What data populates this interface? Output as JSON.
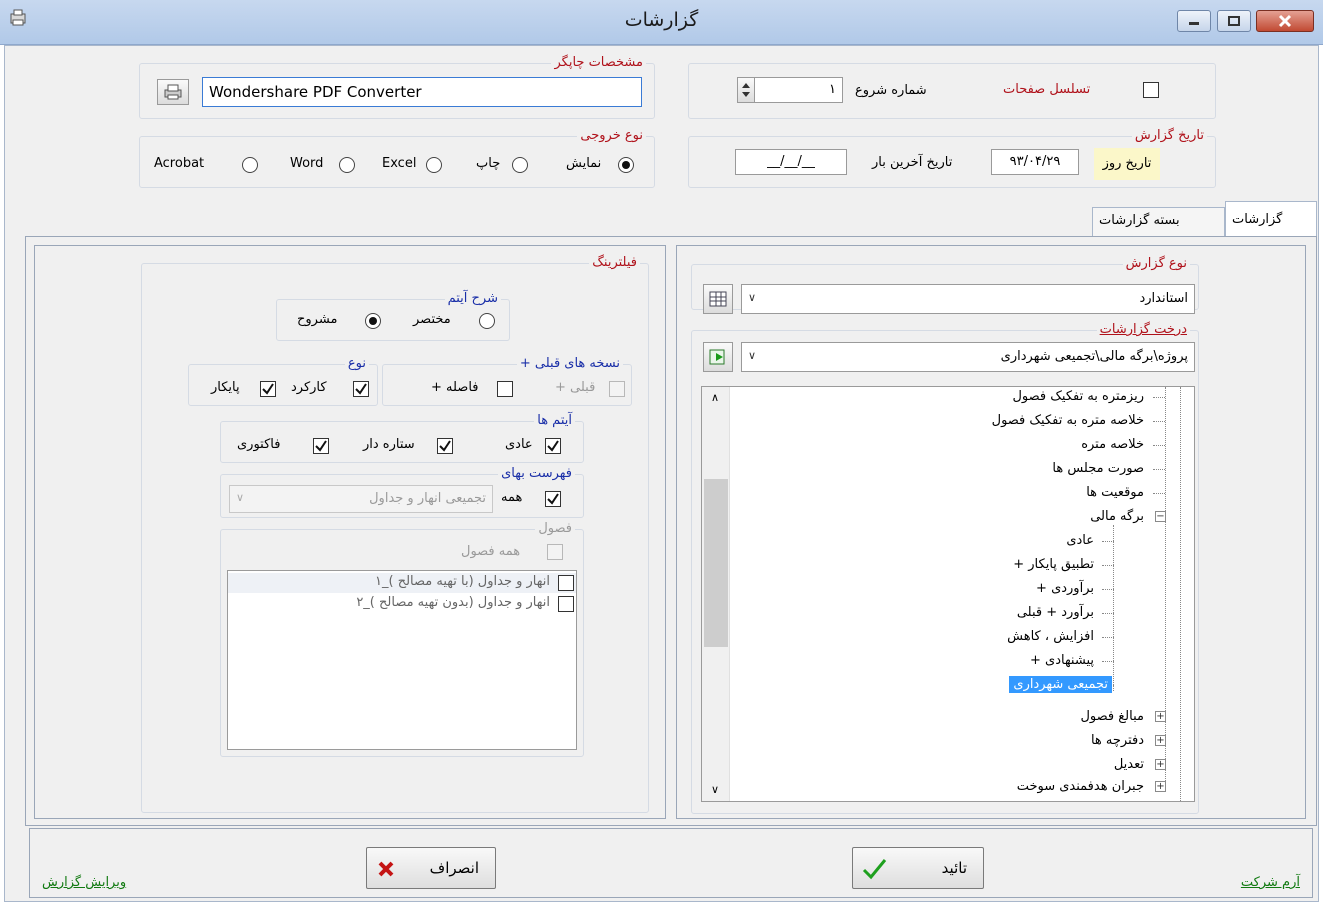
{
  "window": {
    "title": "گزارشات"
  },
  "printer": {
    "legend": "مشخصات چاپگر",
    "name": "Wondershare PDF Converter"
  },
  "pages": {
    "sequence_label": "تسلسل صفحات",
    "start_label": "شماره شروع",
    "start_value": "۱"
  },
  "output": {
    "legend": "نوع خروجی",
    "options": [
      "نمایش",
      "چاپ",
      "Excel",
      "Word",
      "Acrobat"
    ],
    "selected": "نمایش"
  },
  "report_date": {
    "legend": "تاریخ گزارش",
    "today_label": "تاریخ روز",
    "today_value": "۹۳/۰۴/۲۹",
    "last_label": "تاریخ آخرین بار",
    "last_value": "__/__/__"
  },
  "tabs": [
    {
      "label": "گزارشات",
      "active": true
    },
    {
      "label": "بسته گزارشات",
      "active": false
    }
  ],
  "report_type": {
    "legend": "نوع گزارش",
    "value": "استاندارد"
  },
  "report_tree": {
    "legend": "درخت گزارشات",
    "path": "پروژه\\برگه مالی\\تجمیعی شهرداری",
    "items": [
      "ریزمتره به تفکیک فصول",
      "خلاصه متره به تفکیک فصول",
      "خلاصه متره",
      "صورت مجلس ها",
      "موقعیت ها",
      "برگه مالی",
      "عادی",
      "+ تطبیق پایکار",
      "+ برآوردی",
      "برآورد + قبلی",
      "افزایش ، کاهش",
      "+ پیشنهادی",
      "تجمیعی شهرداری",
      "مبالغ فصول",
      "دفترچه ها",
      "تعدیل",
      "جبران هدفمندی سوخت"
    ],
    "selected": "تجمیعی شهرداری"
  },
  "filter": {
    "legend": "فیلترینگ",
    "item_desc": {
      "legend": "شرح آیتم",
      "options": [
        "مشروح",
        "مختصر"
      ],
      "selected": "مشروح"
    },
    "prev_versions": {
      "legend": "+ نسخه های قبلی",
      "options": [
        "+ فاصله",
        "+ قبلی"
      ]
    },
    "kind": {
      "legend": "نوع",
      "options": [
        "کارکرد",
        "پایکار"
      ]
    },
    "items": {
      "legend": "آیتم ها",
      "options": [
        "عادی",
        "ستاره دار",
        "فاکتوری"
      ]
    },
    "price_list": {
      "legend": "فهرست بهای",
      "all_label": "همه",
      "combo_value": "تجمیعی انهار و جداول"
    },
    "chapters": {
      "legend": "فصول",
      "all_label": "همه فصول",
      "rows": [
        "۱_انهار و جداول (با تهیه مصالح )",
        "۲_انهار و جداول (بدون تهیه مصالح )"
      ]
    }
  },
  "footer": {
    "company_logo": "آرم شرکت",
    "confirm": "تائید",
    "cancel": "انصراف",
    "edit_report": "ویرایش گزارش"
  }
}
